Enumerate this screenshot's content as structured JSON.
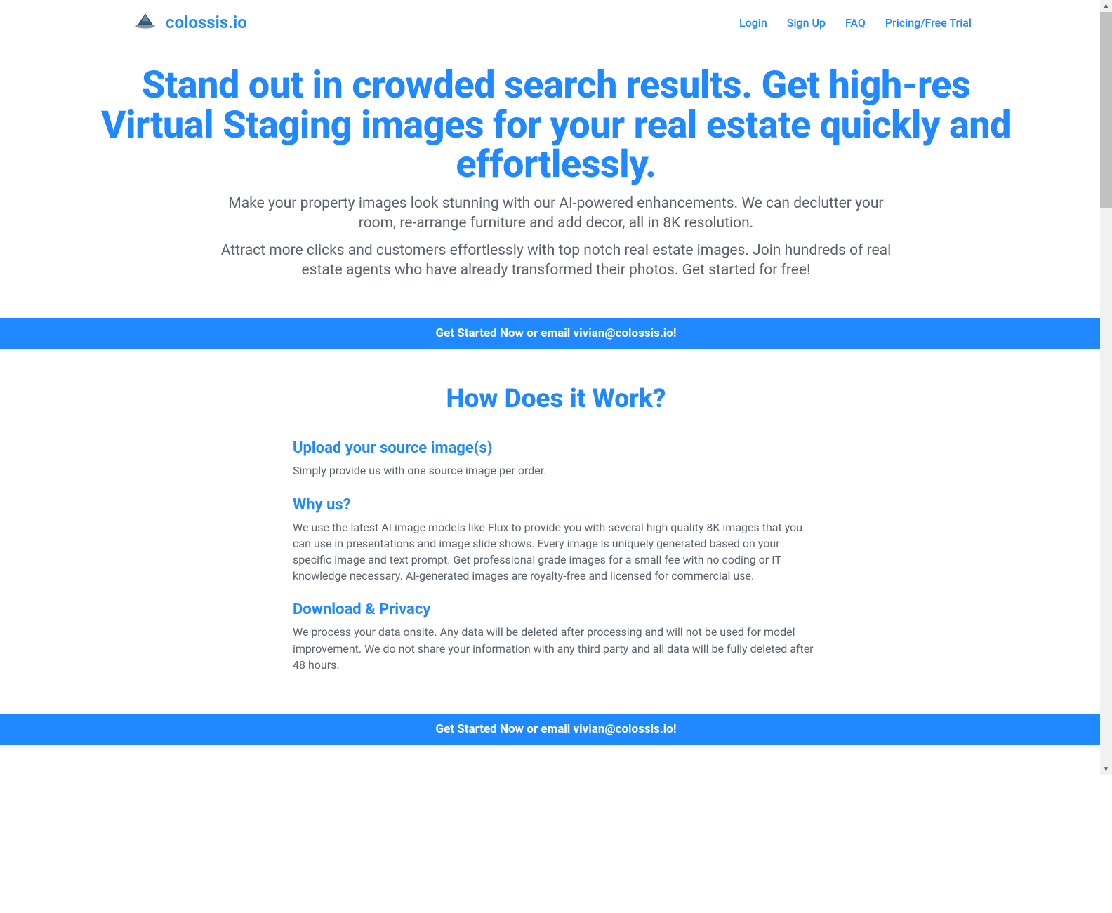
{
  "header": {
    "brand_name": "colossis.io",
    "nav": {
      "login": "Login",
      "signup": "Sign Up",
      "faq": "FAQ",
      "pricing": "Pricing/Free Trial"
    }
  },
  "hero": {
    "headline": "Stand out in crowded search results. Get high-res Virtual Staging images for your real estate quickly and effortlessly.",
    "subtitle1": "Make your property images look stunning with our AI-powered enhancements. We can declutter your room, re-arrange furniture and add decor, all in 8K resolution.",
    "subtitle2": "Attract more clicks and customers effortlessly with top notch real estate images. Join hundreds of real estate agents who have already transformed their photos. Get started for free!"
  },
  "cta1": "Get Started Now or email vivian@colossis.io!",
  "how": {
    "title": "How Does it Work?",
    "steps": [
      {
        "title": "Upload your source image(s)",
        "body": "Simply provide us with one source image per order."
      },
      {
        "title": "Why us?",
        "body": "We use the latest AI image models like Flux to provide you with several high quality 8K images that you can use in presentations and image slide shows. Every image is uniquely generated based on your specific image and text prompt. Get professional grade images for a small fee with no coding or IT knowledge necessary. AI-generated images are royalty-free and licensed for commercial use."
      },
      {
        "title": "Download & Privacy",
        "body": "We process your data onsite. Any data will be deleted after processing and will not be used for model improvement. We do not share your information with any third party and all data will be fully deleted after 48 hours."
      }
    ]
  },
  "cta2": "Get Started Now or email vivian@colossis.io!"
}
